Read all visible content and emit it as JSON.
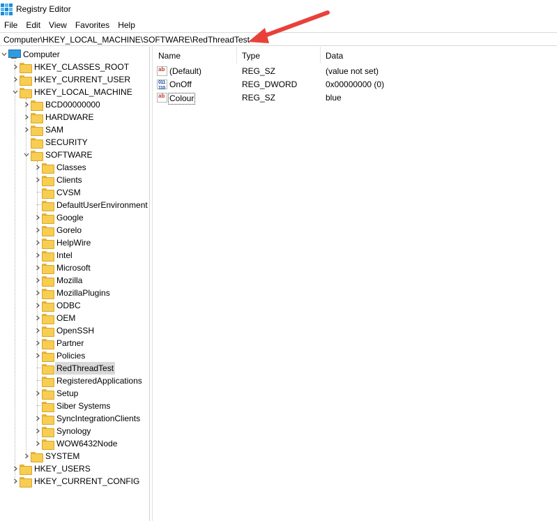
{
  "window": {
    "title": "Registry Editor"
  },
  "menu": [
    "File",
    "Edit",
    "View",
    "Favorites",
    "Help"
  ],
  "address": {
    "path": "Computer\\HKEY_LOCAL_MACHINE\\SOFTWARE\\RedThreadTest"
  },
  "annotation": {
    "arrow_color": "#e8413b"
  },
  "tree": {
    "root": "Computer",
    "hives": {
      "classes_root": "HKEY_CLASSES_ROOT",
      "current_user": "HKEY_CURRENT_USER",
      "local_machine": "HKEY_LOCAL_MACHINE",
      "users": "HKEY_USERS",
      "current_config": "HKEY_CURRENT_CONFIG"
    },
    "hklm_children": [
      "BCD00000000",
      "HARDWARE",
      "SAM",
      "SECURITY",
      "SOFTWARE",
      "SYSTEM"
    ],
    "software_children": [
      "Classes",
      "Clients",
      "CVSM",
      "DefaultUserEnvironment",
      "Google",
      "Gorelo",
      "HelpWire",
      "Intel",
      "Microsoft",
      "Mozilla",
      "MozillaPlugins",
      "ODBC",
      "OEM",
      "OpenSSH",
      "Partner",
      "Policies",
      "RedThreadTest",
      "RegisteredApplications",
      "Setup",
      "Siber Systems",
      "SyncIntegrationClients",
      "Synology",
      "WOW6432Node"
    ],
    "selected": "RedThreadTest"
  },
  "list": {
    "headers": {
      "name": "Name",
      "type": "Type",
      "data": "Data"
    },
    "rows": [
      {
        "name": "(Default)",
        "type": "REG_SZ",
        "data": "(value not set)",
        "icon": "string-value-icon"
      },
      {
        "name": "OnOff",
        "type": "REG_DWORD",
        "data": "0x00000000 (0)",
        "icon": "dword-value-icon"
      },
      {
        "name": "Colour",
        "type": "REG_SZ",
        "data": "blue",
        "icon": "string-value-icon"
      }
    ]
  }
}
